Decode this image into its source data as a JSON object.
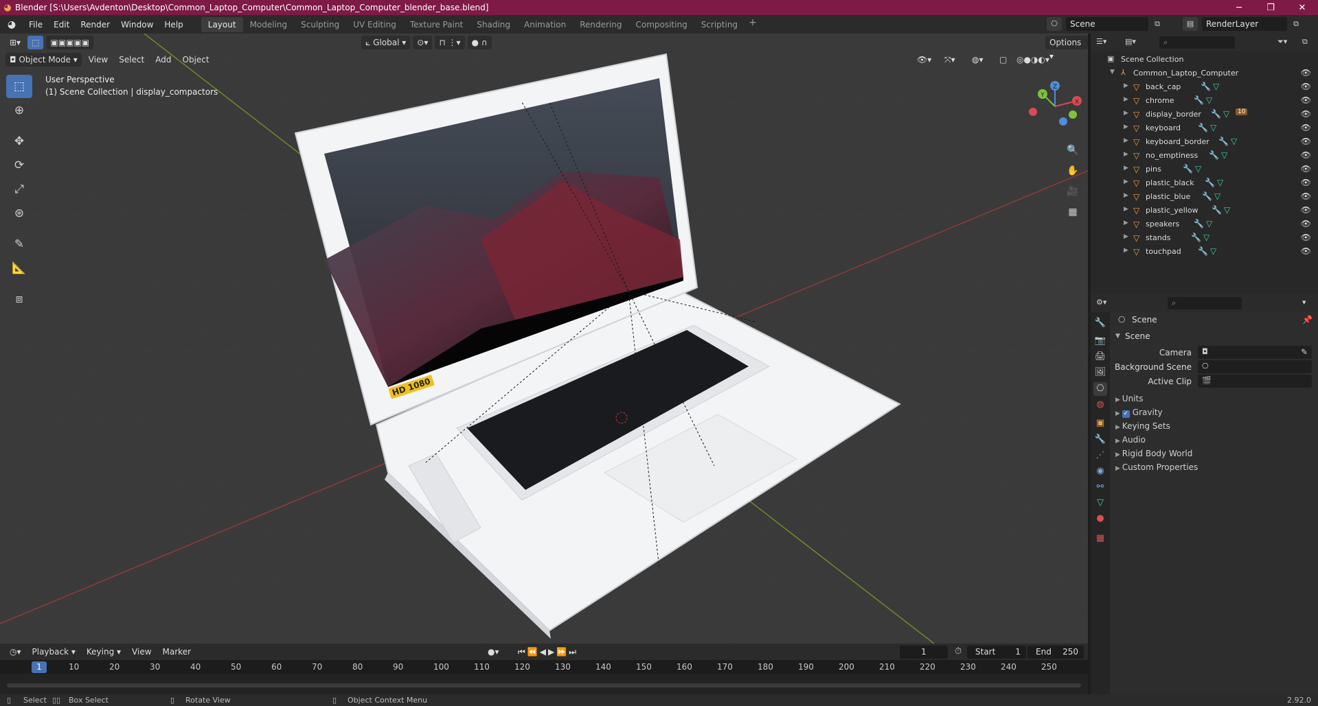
{
  "window": {
    "title": "Blender [S:\\Users\\Avdenton\\Desktop\\Common_Laptop_Computer\\Common_Laptop_Computer_blender_base.blend]",
    "minimize": "─",
    "maximize": "❐",
    "close": "✕"
  },
  "menu": [
    "File",
    "Edit",
    "Render",
    "Window",
    "Help"
  ],
  "workspaces": [
    "Layout",
    "Modeling",
    "Sculpting",
    "UV Editing",
    "Texture Paint",
    "Shading",
    "Animation",
    "Rendering",
    "Compositing",
    "Scripting"
  ],
  "workspace_add": "+",
  "scene_name": "Scene",
  "render_layer": "RenderLayer",
  "viewport": {
    "transform": "Global",
    "options": "Options",
    "mode": "Object Mode",
    "menus": [
      "View",
      "Select",
      "Add",
      "Object"
    ],
    "overlay_line1": "User Perspective",
    "overlay_line2": "(1) Scene Collection | display_compactors",
    "badge": "HD 1080",
    "gizmo": {
      "x": "X",
      "y": "Y",
      "z": "Z"
    }
  },
  "outliner": {
    "root": "Scene Collection",
    "collection": "Common_Laptop_Computer",
    "objects": [
      "back_cap",
      "chrome",
      "display_border",
      "keyboard",
      "keyboard_border",
      "no_emptiness",
      "pins",
      "plastic_black",
      "plastic_blue",
      "plastic_yellow",
      "speakers",
      "stands",
      "touchpad"
    ],
    "display_border_badge": "10"
  },
  "properties": {
    "breadcrumb": "Scene",
    "panel": "Scene",
    "camera_label": "Camera",
    "bg_scene_label": "Background Scene",
    "active_clip_label": "Active Clip",
    "sections": [
      "Units",
      "Gravity",
      "Keying Sets",
      "Audio",
      "Rigid Body World",
      "Custom Properties"
    ]
  },
  "timeline": {
    "menus": [
      "Playback",
      "Keying",
      "View",
      "Marker"
    ],
    "current_frame": "1",
    "start_label": "Start",
    "start": "1",
    "end_label": "End",
    "end": "250",
    "ticks": [
      "10",
      "20",
      "30",
      "40",
      "50",
      "60",
      "70",
      "80",
      "90",
      "100",
      "110",
      "120",
      "130",
      "140",
      "150",
      "160",
      "170",
      "180",
      "190",
      "200",
      "210",
      "220",
      "230",
      "240",
      "250"
    ]
  },
  "status": {
    "select": "Select",
    "box_select": "Box Select",
    "rotate_view": "Rotate View",
    "context_menu": "Object Context Menu",
    "version": "2.92.0"
  }
}
